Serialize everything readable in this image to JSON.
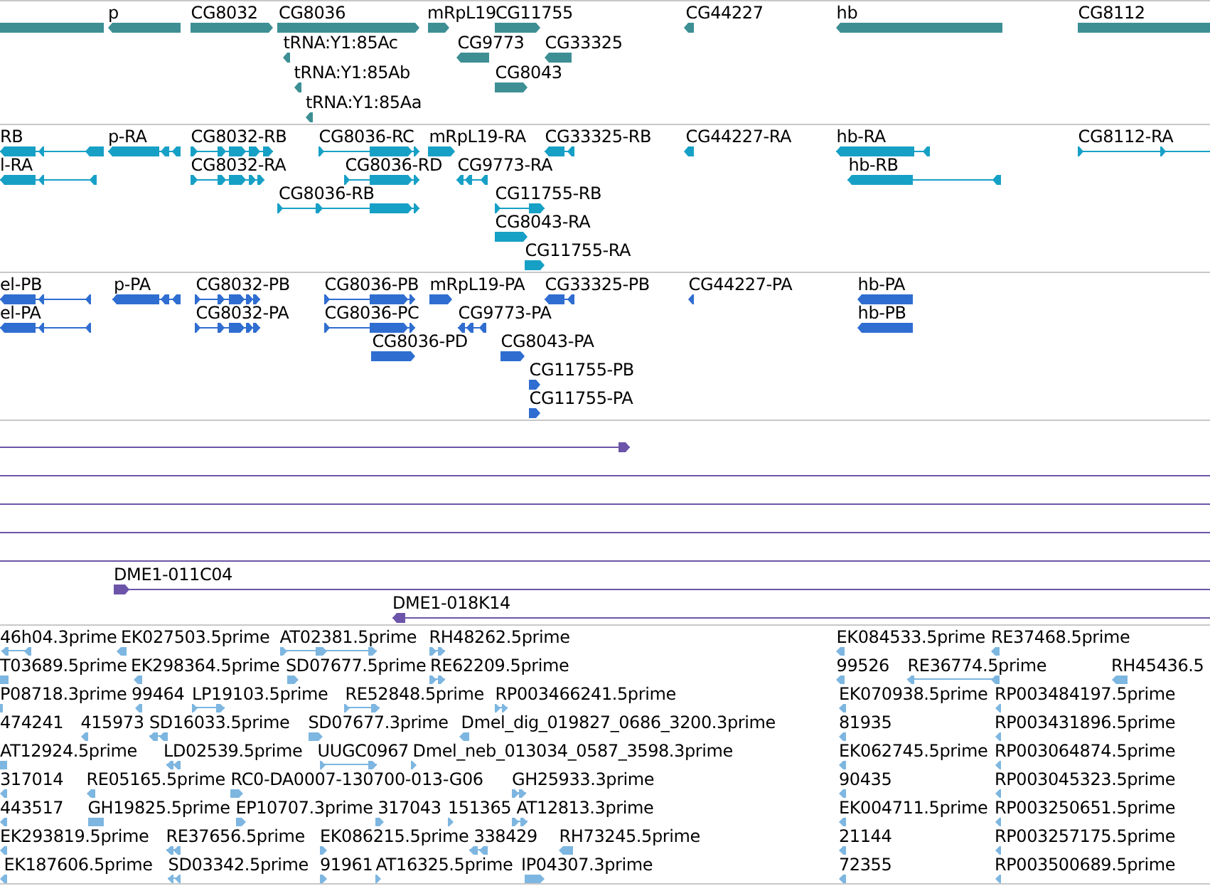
{
  "tracks": [
    {
      "kind": "gene",
      "rows": [
        {
          "features": [
            {
              "continues_left": true
            },
            {
              "label": "p",
              "reverse": true
            },
            {
              "label": "CG8032",
              "reverse": false
            },
            {
              "label": "CG8036",
              "reverse": false
            },
            {
              "label": "mRpL19",
              "reverse": false
            },
            {
              "label": "CG11755",
              "reverse": false
            },
            {
              "label": "CG44227",
              "reverse": true
            },
            {
              "label": "hb",
              "reverse": true
            },
            {
              "label": "CG8112",
              "continues_right": true
            }
          ]
        },
        {
          "features": [
            {
              "label": "tRNA:Y1:85Ac",
              "reverse": true
            },
            {
              "label": "CG9773",
              "reverse": true
            },
            {
              "label": "CG33325",
              "reverse": true
            }
          ]
        },
        {
          "features": [
            {
              "label": "tRNA:Y1:85Ab",
              "reverse": true
            },
            {
              "label": "CG8043",
              "reverse": false
            }
          ]
        },
        {
          "features": [
            {
              "label": "tRNA:Y1:85Aa",
              "reverse": true
            }
          ]
        }
      ]
    },
    {
      "kind": "transcript",
      "rows": [
        {
          "features": [
            {
              "label": "RB",
              "reverse": true,
              "continues_left": true
            },
            {
              "label": "p-RA",
              "reverse": true
            },
            {
              "label": "CG8032-RB",
              "reverse": false
            },
            {
              "label": "CG8036-RC",
              "reverse": false
            },
            {
              "label": "mRpL19-RA",
              "reverse": false
            },
            {
              "label": "CG33325-RB",
              "reverse": true
            },
            {
              "label": "CG44227-RA",
              "reverse": true
            },
            {
              "label": "hb-RA",
              "reverse": true
            },
            {
              "label": "CG8112-RA",
              "reverse": false,
              "continues_right": true
            }
          ]
        },
        {
          "features": [
            {
              "label": "l-RA",
              "reverse": true,
              "continues_left": true
            },
            {
              "label": "CG8032-RA",
              "reverse": false
            },
            {
              "label": "CG8036-RD",
              "reverse": false
            },
            {
              "label": "CG9773-RA",
              "reverse": true
            },
            {
              "label": "hb-RB",
              "reverse": true
            }
          ]
        },
        {
          "features": [
            {
              "label": "CG8036-RB",
              "reverse": false
            },
            {
              "label": "CG11755-RB",
              "reverse": false
            }
          ]
        },
        {
          "features": [
            {
              "label": "CG8043-RA",
              "reverse": false
            }
          ]
        },
        {
          "features": [
            {
              "label": "CG11755-RA",
              "reverse": false
            }
          ]
        }
      ]
    },
    {
      "kind": "protein",
      "rows": [
        {
          "features": [
            {
              "label": "el-PB",
              "reverse": true,
              "continues_left": true
            },
            {
              "label": "p-PA",
              "reverse": true
            },
            {
              "label": "CG8032-PB",
              "reverse": false
            },
            {
              "label": "CG8036-PB",
              "reverse": false
            },
            {
              "label": "mRpL19-PA",
              "reverse": false
            },
            {
              "label": "CG33325-PB",
              "reverse": true
            },
            {
              "label": "CG44227-PA",
              "reverse": true
            },
            {
              "label": "hb-PA",
              "reverse": true
            }
          ]
        },
        {
          "features": [
            {
              "label": "el-PA",
              "reverse": true,
              "continues_left": true
            },
            {
              "label": "CG8032-PA",
              "reverse": false
            },
            {
              "label": "CG8036-PC",
              "reverse": false
            },
            {
              "label": "CG9773-PA",
              "reverse": true
            },
            {
              "label": "hb-PB",
              "reverse": true
            }
          ]
        },
        {
          "features": [
            {
              "label": "CG8036-PD",
              "reverse": false
            },
            {
              "label": "CG8043-PA",
              "reverse": false
            }
          ]
        },
        {
          "features": [
            {
              "label": "CG11755-PB",
              "reverse": false
            }
          ]
        },
        {
          "features": [
            {
              "label": "CG11755-PA",
              "reverse": false
            }
          ]
        }
      ]
    },
    {
      "kind": "clone",
      "rows": [
        {
          "features": [
            {
              "reverse": false,
              "continues_left": true
            }
          ]
        },
        {
          "features": [
            {
              "continues_left": true,
              "continues_right": true
            }
          ]
        },
        {
          "features": [
            {
              "continues_left": true,
              "continues_right": true
            }
          ]
        },
        {
          "features": [
            {
              "continues_left": true,
              "continues_right": true
            }
          ]
        },
        {
          "features": [
            {
              "continues_left": true,
              "continues_right": true
            }
          ]
        },
        {
          "features": [
            {
              "label": "DME1-011C04",
              "reverse": false,
              "continues_right": true
            }
          ]
        },
        {
          "features": [
            {
              "label": "DME1-018K14",
              "reverse": true,
              "continues_right": true
            }
          ]
        }
      ]
    },
    {
      "kind": "est",
      "rows": [
        {
          "features": [
            {
              "label": "46h04.3prime",
              "reverse": true
            },
            {
              "label": "EK027503.5prime",
              "reverse": true
            },
            {
              "label": "AT02381.5prime",
              "reverse": false
            },
            {
              "label": "RH48262.5prime",
              "reverse": false
            },
            {
              "label": "EK084533.5prime",
              "reverse": true
            },
            {
              "label": "RE37468.5prime",
              "reverse": true
            }
          ]
        },
        {
          "features": [
            {
              "label": "T03689.5prime",
              "continues_left": true
            },
            {
              "label": "EK298364.5prime",
              "reverse": true
            },
            {
              "label": "SD07677.5prime",
              "reverse": false
            },
            {
              "label": "RE62209.5prime",
              "reverse": false
            },
            {
              "label": "99526",
              "reverse": true
            },
            {
              "label": "RE36774.5prime",
              "reverse": true
            },
            {
              "label": "RH45436.5",
              "reverse": true
            }
          ]
        },
        {
          "features": [
            {
              "label": "P08718.3prime",
              "continues_left": true
            },
            {
              "label": "99464",
              "reverse": true
            },
            {
              "label": "LP19103.5prime",
              "reverse": false
            },
            {
              "label": "RE52848.5prime",
              "reverse": false
            },
            {
              "label": "RP003466241.5prime",
              "reverse": false
            },
            {
              "label": "EK070938.5prime",
              "reverse": true
            },
            {
              "label": "RP003484197.5prime",
              "reverse": true
            }
          ]
        },
        {
          "features": [
            {
              "label": "474241"
            },
            {
              "label": "415973",
              "reverse": true
            },
            {
              "label": "SD16033.5prime",
              "reverse": true
            },
            {
              "label": "SD07677.3prime",
              "reverse": false
            },
            {
              "label": "Dmel_dig_019827_0686_3200.3prime",
              "reverse": true
            },
            {
              "label": "81935",
              "reverse": true
            },
            {
              "label": "RP003431896.5prime",
              "reverse": true
            }
          ]
        },
        {
          "features": [
            {
              "label": "AT12924.5prime"
            },
            {
              "label": "LD02539.5prime",
              "reverse": true
            },
            {
              "label": "UUGC0967",
              "reverse": false
            },
            {
              "label": "Dmel_neb_013034_0587_3598.3prime",
              "reverse": false
            },
            {
              "label": "EK062745.5prime",
              "reverse": true
            },
            {
              "label": "RP003064874.5prime",
              "reverse": true
            }
          ]
        },
        {
          "features": [
            {
              "label": "317014",
              "reverse": true
            },
            {
              "label": "RE05165.5prime",
              "reverse": true
            },
            {
              "label": "RC0-DA0007-130700-013-G06",
              "reverse": false
            },
            {
              "label": "GH25933.3prime",
              "reverse": false
            },
            {
              "label": "90435",
              "reverse": true
            },
            {
              "label": "RP003045323.5prime",
              "reverse": true
            }
          ]
        },
        {
          "features": [
            {
              "label": "443517",
              "reverse": true
            },
            {
              "label": "GH19825.5prime"
            },
            {
              "label": "EP10707.3prime",
              "reverse": false
            },
            {
              "label": "317043",
              "reverse": false
            },
            {
              "label": "151365",
              "reverse": false
            },
            {
              "label": "AT12813.3prime",
              "reverse": false
            },
            {
              "label": "EK004711.5prime",
              "reverse": true
            },
            {
              "label": "RP003250651.5prime",
              "reverse": true
            }
          ]
        },
        {
          "features": [
            {
              "label": "EK293819.5prime",
              "reverse": true
            },
            {
              "label": "RE37656.5prime",
              "reverse": true
            },
            {
              "label": "EK086215.5prime",
              "reverse": false
            },
            {
              "label": "338429",
              "reverse": true
            },
            {
              "label": "RH73245.5prime",
              "reverse": true
            },
            {
              "label": "21144",
              "reverse": true
            },
            {
              "label": "RP003257175.5prime",
              "reverse": true
            }
          ]
        },
        {
          "features": [
            {
              "label": "EK187606.5prime",
              "reverse": true
            },
            {
              "label": "SD03342.5prime",
              "reverse": true
            },
            {
              "label": "91961",
              "reverse": false
            },
            {
              "label": "AT16325.5prime",
              "reverse": false
            },
            {
              "label": "IP04307.3prime",
              "reverse": false
            },
            {
              "label": "72355",
              "reverse": true
            },
            {
              "label": "RP003500689.5prime",
              "reverse": true
            }
          ]
        }
      ]
    }
  ]
}
